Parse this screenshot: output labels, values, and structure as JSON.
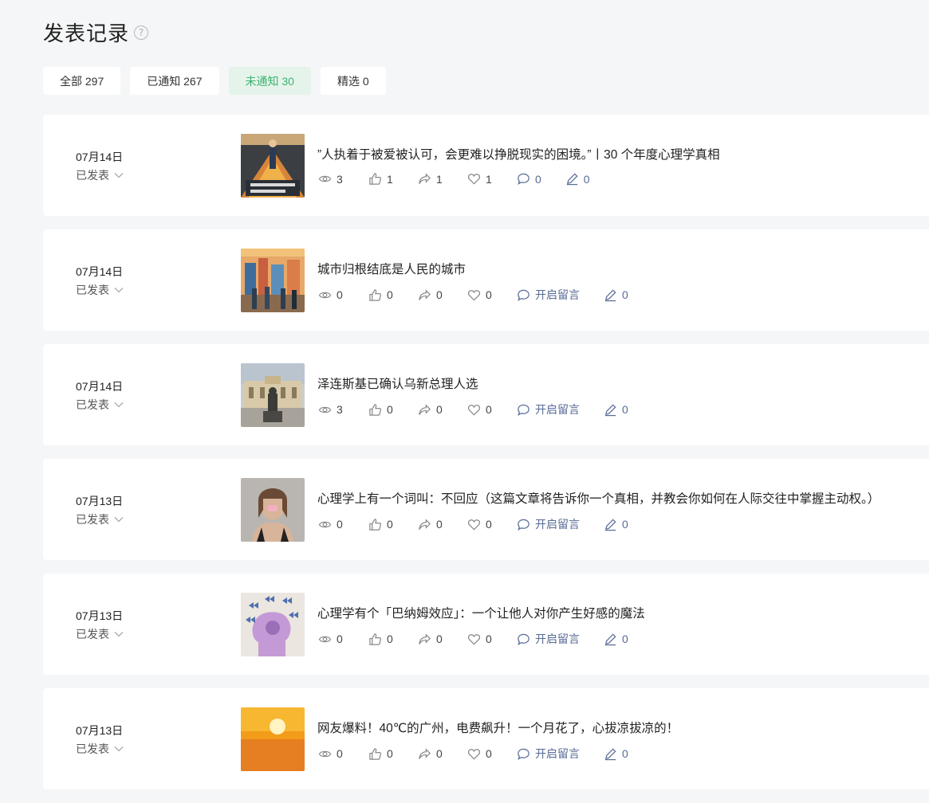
{
  "page": {
    "title": "发表记录",
    "help_icon": "question-circle-icon"
  },
  "tabs": [
    {
      "label": "全部 297",
      "active": false
    },
    {
      "label": "已通知 267",
      "active": false
    },
    {
      "label": "未通知 30",
      "active": true
    },
    {
      "label": "精选 0",
      "active": false
    }
  ],
  "colors": {
    "accent": "#3cb371",
    "link": "#576b95",
    "card": "#ffffff",
    "background": "#f5f6f7"
  },
  "articles": [
    {
      "date": "07月14日",
      "status": "已发表",
      "title": "”人执着于被爱被认可，会更难以挣脱现实的困境。”丨30 个年度心理学真相",
      "reads": "3",
      "likes": "1",
      "shares": "1",
      "favorites": "1",
      "comments": "0",
      "notes": "0"
    },
    {
      "date": "07月14日",
      "status": "已发表",
      "title": "城市归根结底是人民的城市",
      "reads": "0",
      "likes": "0",
      "shares": "0",
      "favorites": "0",
      "comments": "开启留言",
      "notes": "0"
    },
    {
      "date": "07月14日",
      "status": "已发表",
      "title": "泽连斯基已确认乌新总理人选",
      "reads": "3",
      "likes": "0",
      "shares": "0",
      "favorites": "0",
      "comments": "开启留言",
      "notes": "0"
    },
    {
      "date": "07月13日",
      "status": "已发表",
      "title": "心理学上有一个词叫：不回应（这篇文章将告诉你一个真相，并教会你如何在人际交往中掌握主动权。）",
      "reads": "0",
      "likes": "0",
      "shares": "0",
      "favorites": "0",
      "comments": "开启留言",
      "notes": "0"
    },
    {
      "date": "07月13日",
      "status": "已发表",
      "title": "心理学有个「巴纳姆效应」：一个让他人对你产生好感的魔法",
      "reads": "0",
      "likes": "0",
      "shares": "0",
      "favorites": "0",
      "comments": "开启留言",
      "notes": "0"
    },
    {
      "date": "07月13日",
      "status": "已发表",
      "title": "网友爆料！40℃的广州，电费飙升！一个月花了，心拔凉拔凉的！",
      "reads": "0",
      "likes": "0",
      "shares": "0",
      "favorites": "0",
      "comments": "开启留言",
      "notes": "0"
    }
  ]
}
